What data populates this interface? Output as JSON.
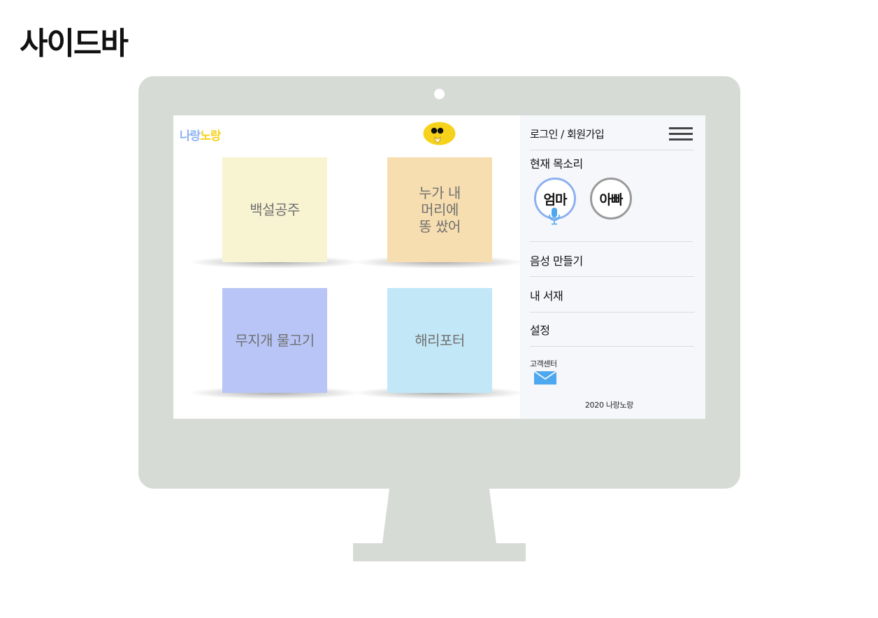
{
  "page": {
    "title": "사이드바"
  },
  "app": {
    "logo_part1": "나랑",
    "logo_part2": "노랑"
  },
  "books": [
    {
      "title": "백설공주",
      "color": "#f8f4d2"
    },
    {
      "title": "누가 내\n머리에\n똥 쌌어",
      "color": "#f7deb0"
    },
    {
      "title": "무지개 물고기",
      "color": "#b8c5f6"
    },
    {
      "title": "해리포터",
      "color": "#c2e7f7"
    }
  ],
  "sidebar": {
    "login_label": "로그인 / 회원가입",
    "voice_heading": "현재 목소리",
    "voices": [
      {
        "label": "엄마",
        "selected": true
      },
      {
        "label": "아빠",
        "selected": false
      }
    ],
    "menu": [
      {
        "label": "음성 만들기"
      },
      {
        "label": "내 서재"
      },
      {
        "label": "설정"
      }
    ],
    "support_label": "고객센터",
    "footer": "2020 나랑노랑"
  },
  "colors": {
    "monitor": "#d7dbd6",
    "sidebar_bg": "#f6f7fb",
    "accent_blue": "#8db1f0",
    "brand_yellow": "#f7d21a",
    "mail_blue": "#4ea8ef"
  },
  "icons": {
    "menu": "hamburger-icon",
    "voice": "microphone-icon",
    "support": "mail-icon",
    "mascot": "mascot-face-icon"
  }
}
